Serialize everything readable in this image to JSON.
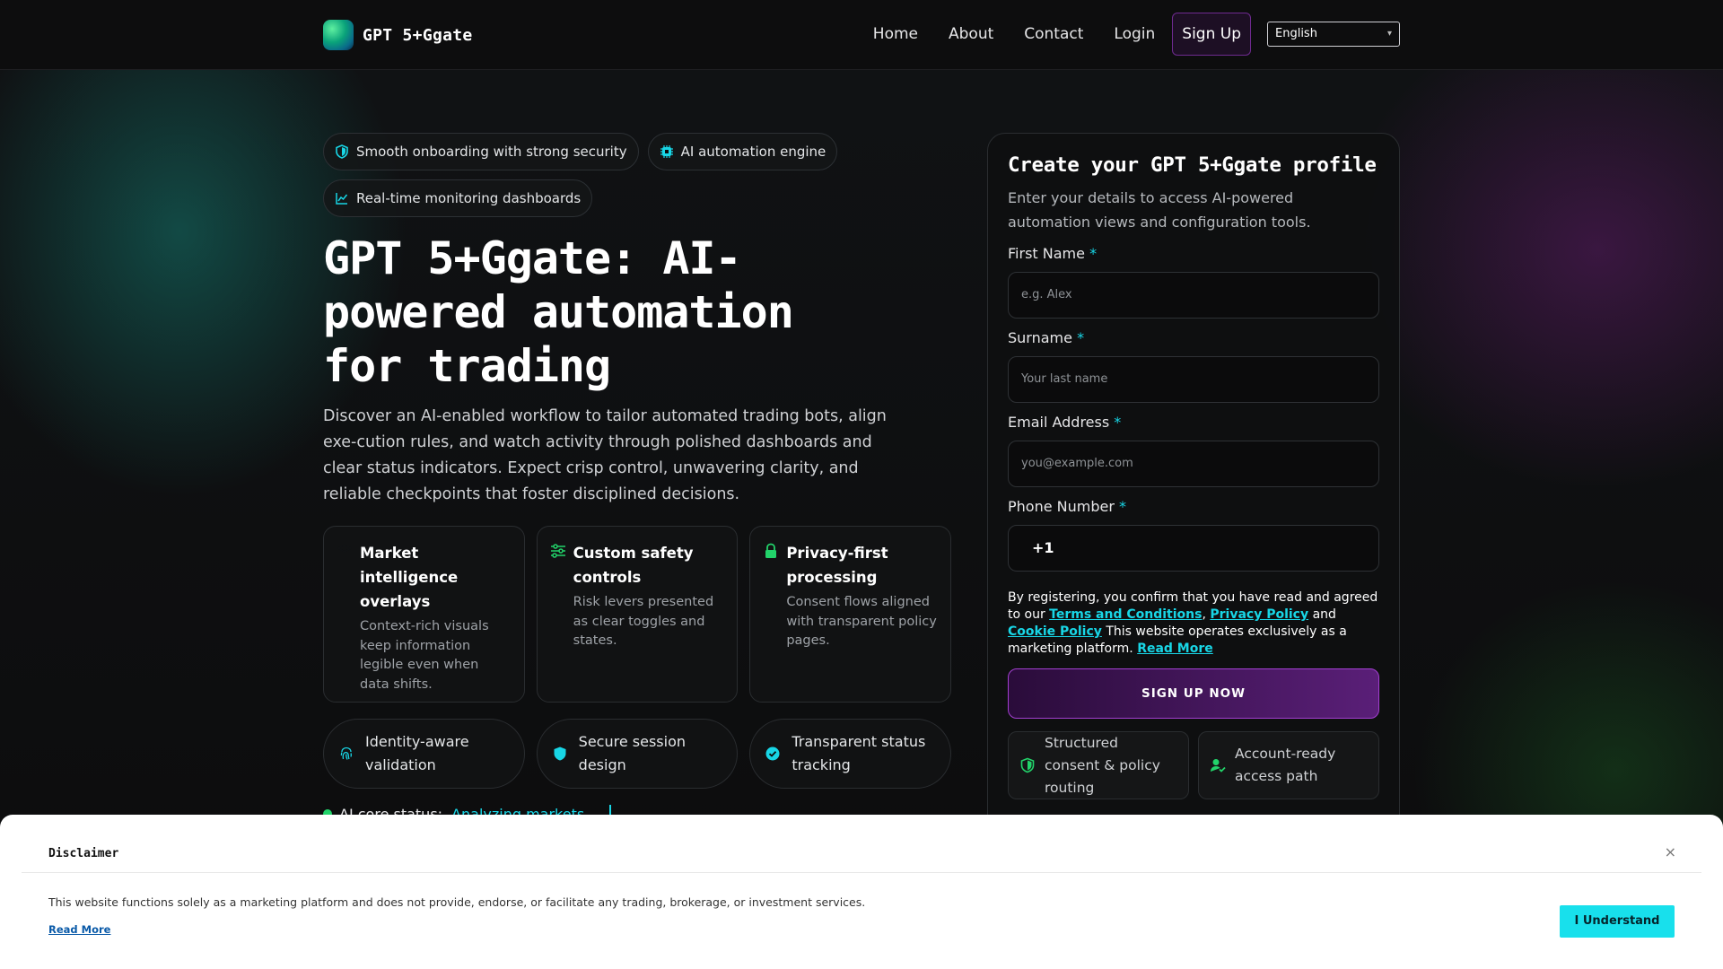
{
  "header": {
    "brand": "GPT 5+Ggate",
    "nav": [
      "Home",
      "About",
      "Contact",
      "Login"
    ],
    "signup": "Sign Up",
    "language": "English"
  },
  "hero": {
    "pills": [
      {
        "label": "Smooth onboarding with strong security",
        "icon": "shield-icon"
      },
      {
        "label": "AI automation engine",
        "icon": "chip-icon"
      },
      {
        "label": "Real-time monitoring dashboards",
        "icon": "chart-line-icon"
      }
    ],
    "title": "GPT 5+Ggate: AI-powered automation for trading",
    "description": "Discover an AI-enabled workflow to tailor automated trading bots, align exe-cution rules, and watch activity through polished dashboards and clear status indicators. Expect crisp control, unwavering clarity, and reliable checkpoints that foster disciplined decisions.",
    "features": [
      {
        "title": "Market intelligence overlays",
        "text": "Context-rich visuals keep information legible even when data shifts.",
        "icon": "layers-icon"
      },
      {
        "title": "Custom safety controls",
        "text": "Risk levers presented as clear toggles and states.",
        "icon": "sliders-icon"
      },
      {
        "title": "Privacy-first processing",
        "text": "Consent flows aligned with transparent policy pages.",
        "icon": "lock-icon"
      }
    ],
    "badges": [
      {
        "label": "Identity-aware validation",
        "icon": "fingerprint-icon"
      },
      {
        "label": "Secure session design",
        "icon": "shield-icon"
      },
      {
        "label": "Transparent status tracking",
        "icon": "check-circle-icon"
      }
    ],
    "status_label": "AI core status:",
    "status_value": "Analyzing markets"
  },
  "form": {
    "title": "Create your GPT 5+Ggate profile",
    "subtitle": "Enter your details to access AI-powered automation views and configuration tools.",
    "fields": [
      {
        "label": "First Name",
        "placeholder": "e.g. Alex"
      },
      {
        "label": "Surname",
        "placeholder": "Your last name"
      },
      {
        "label": "Email Address",
        "placeholder": "you@example.com"
      },
      {
        "label": "Phone Number",
        "value": "+1"
      }
    ],
    "required_mark": "*",
    "consent_prefix": "By registering, you confirm that you have read and agreed to our",
    "terms": "Terms and Conditions",
    "privacy": "Privacy Policy",
    "and": "and",
    "cookie": "Cookie Policy",
    "consent_suffix": "This website operates exclusively as a marketing platform.",
    "read_more": "Read More",
    "submit": "SIGN UP NOW",
    "mini": [
      {
        "label": "Structured consent & policy routing",
        "icon": "shield-icon"
      },
      {
        "label": "Account-ready access path",
        "icon": "user-check-icon"
      }
    ]
  },
  "disclaimer": {
    "title": "Disclaimer",
    "close": "×",
    "text": "This website functions solely as a marketing platform and does not provide, endorse, or facilitate any trading, brokerage, or investment services.",
    "read_more": "Read More",
    "button": "I Understand"
  },
  "colors": {
    "accent": "#18d6e6",
    "purple": "#6e2a8f",
    "green": "#22d36a"
  }
}
